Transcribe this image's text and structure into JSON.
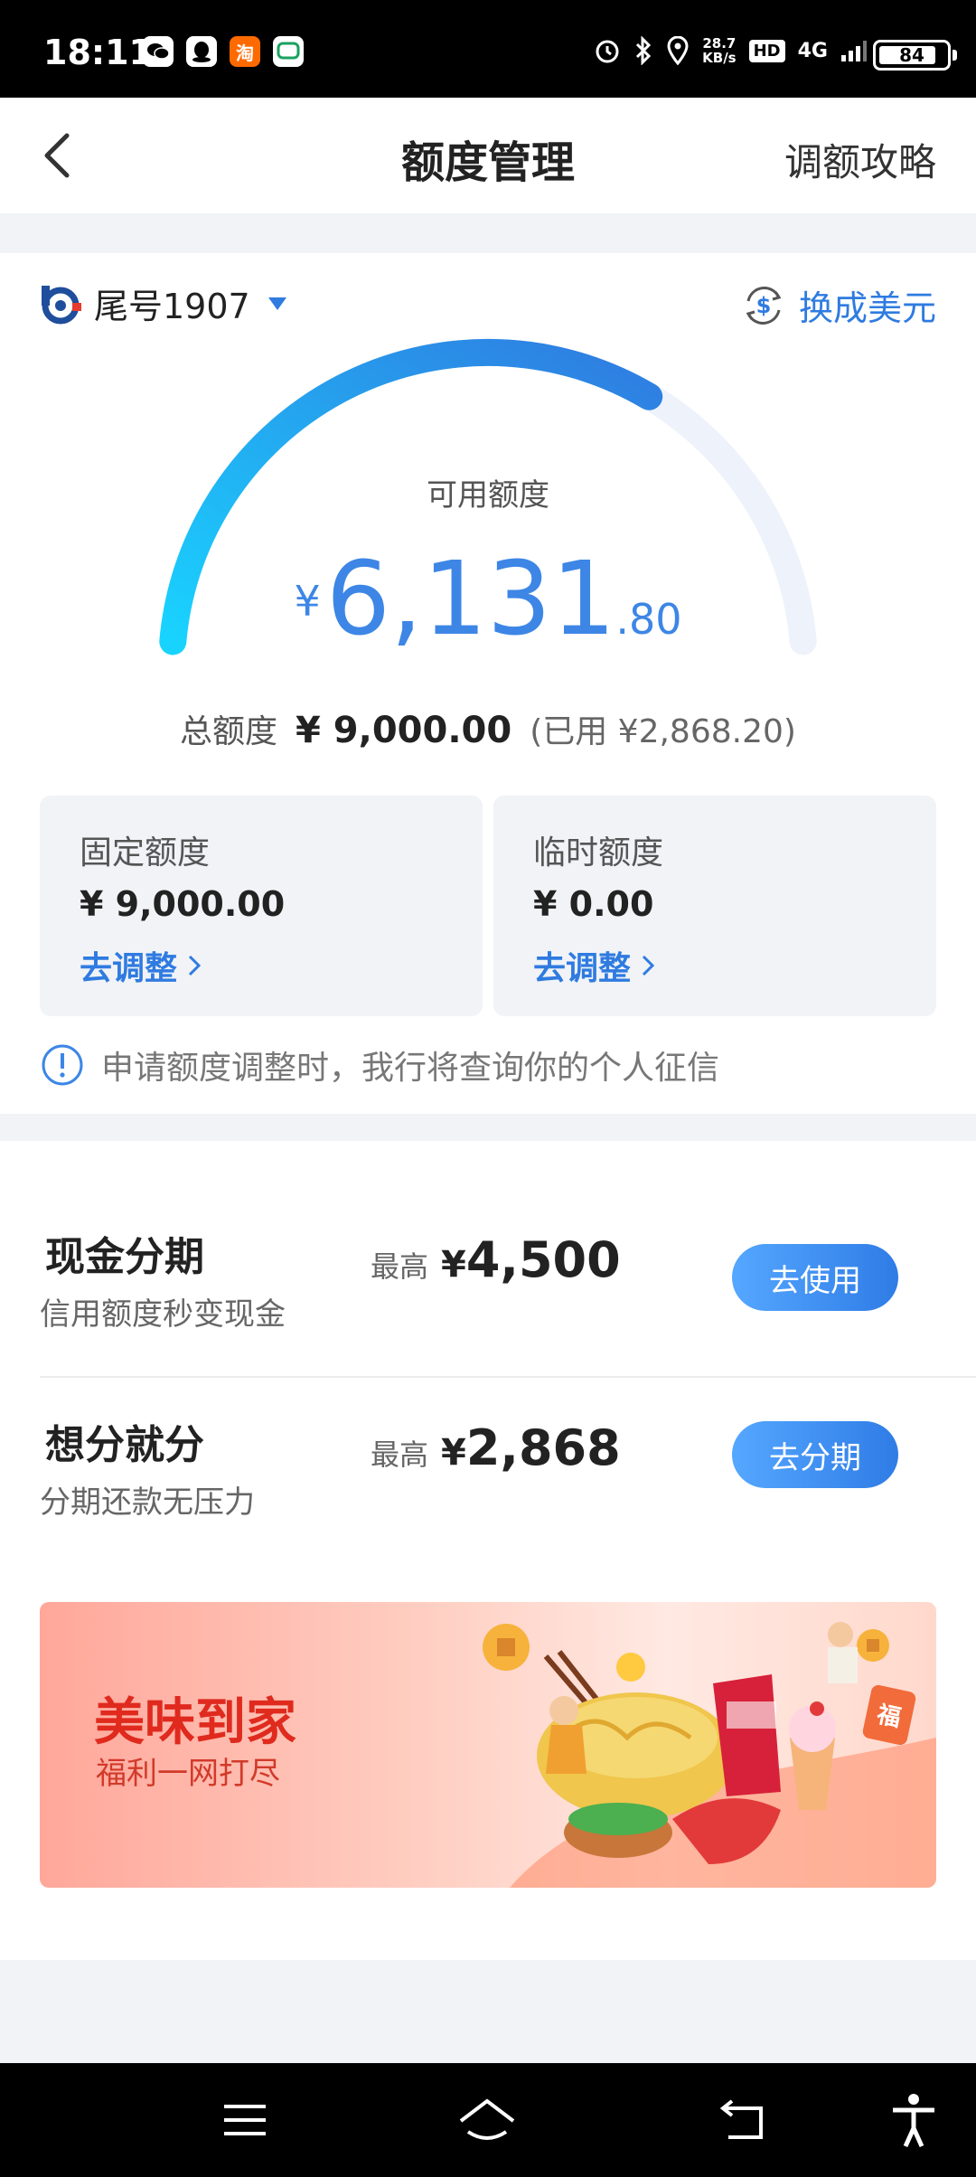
{
  "status_bar": {
    "time": "18:11",
    "network_speed_value": "28.7",
    "network_speed_unit": "KB/s",
    "hd": "HD",
    "network": "4G",
    "battery": "84",
    "battery_level": 0.84,
    "app_icons": [
      "wechat-icon",
      "qq-icon",
      "taobao-icon",
      "messages-icon"
    ],
    "taobao_glyph": "淘"
  },
  "header": {
    "title": "额度管理",
    "right_link": "调额攻略"
  },
  "account": {
    "label": "尾号1907",
    "convert_label": "换成美元"
  },
  "credit": {
    "available_label": "可用额度",
    "currency": "¥",
    "available_int": "6,131",
    "available_dec": ".80",
    "used_fraction": 0.68,
    "total_label": "总额度",
    "total_amount": "¥ 9,000.00",
    "used_text": "(已用 ¥2,868.20)"
  },
  "quotas": [
    {
      "label": "固定额度",
      "amount": "¥ 9,000.00",
      "link": "去调整"
    },
    {
      "label": "临时额度",
      "amount": "¥ 0.00",
      "link": "去调整"
    }
  ],
  "notice": "申请额度调整时，我行将查询你的个人征信",
  "installments": [
    {
      "title": "现金分期",
      "subtitle": "信用额度秒变现金",
      "max_label": "最高",
      "currency": "¥",
      "value": "4,500",
      "button": "去使用"
    },
    {
      "title": "想分就分",
      "subtitle": "分期还款无压力",
      "max_label": "最高",
      "currency": "¥",
      "value": "2,868",
      "button": "去分期"
    }
  ],
  "banner": {
    "title": "美味到家",
    "subtitle": "福利一网打尽",
    "badge_glyph": "福"
  },
  "colors": {
    "accent": "#2f7be0",
    "gauge_start": "#19d3ff",
    "gauge_end": "#2f7be0",
    "banner_title": "#e02a1e"
  }
}
